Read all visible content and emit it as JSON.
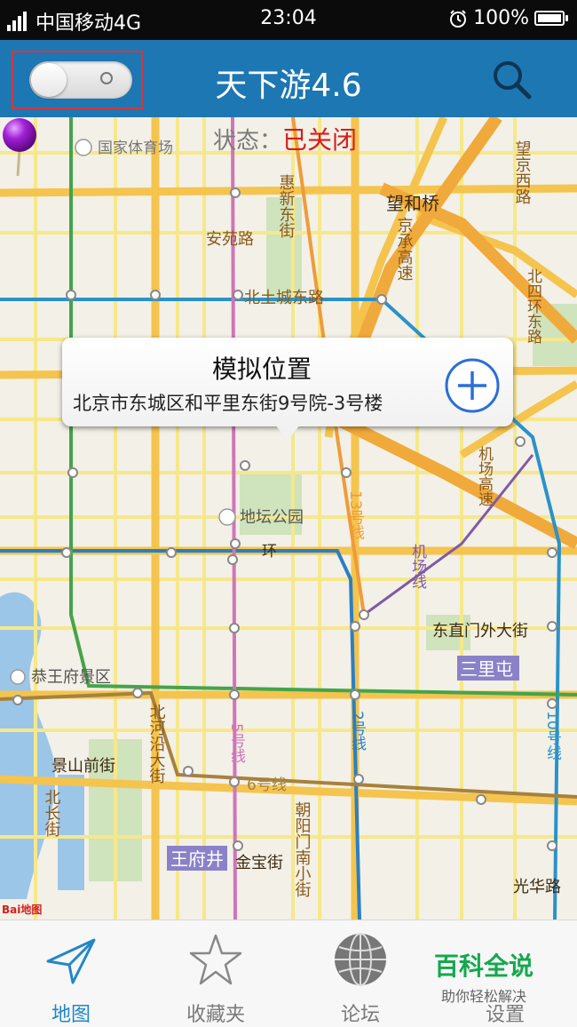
{
  "status_bar": {
    "network_tag": "4G",
    "carrier": "中国移动4G",
    "time": "23:04",
    "battery": "100%",
    "battery_level": 1.0
  },
  "header": {
    "title": "天下游4.6",
    "toggle_on": false
  },
  "map": {
    "status_label": "状态：",
    "status_value": "已关闭",
    "status_color": "#d41e1e",
    "labels": {
      "gymnasium": "国家体育场",
      "anyuan_road": "安苑路",
      "huixin_east": "惠新东街",
      "beituchengdong": "北土城东路",
      "wanghe_bridge": "望和桥",
      "jingcheng_expwy": "京承高速",
      "north_4th_ring": "北四环东路",
      "wangjing_west": "望京西路",
      "ditan_park": "地坛公园",
      "line13": "13号线",
      "airport_line": "机场线",
      "airport_expwy": "机场高速",
      "dongzhimen": "东直门外大街",
      "sanlitun": "三里屯",
      "gongwangfu": "恭王府景区",
      "beiheyan": "北河沿大街",
      "line5": "5号线",
      "line2": "2号线",
      "line6": "6号线",
      "line10": "10号线",
      "jingshan_front": "景山前街",
      "beichang": "北长街",
      "chaoyangmen": "朝阳门南小街",
      "wangfujing": "王府井",
      "jinbao": "金宝街",
      "guanghua": "光华路",
      "ring": "环",
      "baidu": "Bai地图"
    }
  },
  "popup": {
    "title": "模拟位置",
    "address": "北京市东城区和平里东街9号院-3号楼"
  },
  "bottom_nav": {
    "items": [
      {
        "label": "地图",
        "icon": "paper-plane-icon",
        "active": true
      },
      {
        "label": "收藏夹",
        "icon": "star-icon",
        "active": false
      },
      {
        "label": "论坛",
        "icon": "globe-icon",
        "active": false
      },
      {
        "label": "设置",
        "icon": "settings-icon",
        "active": false
      }
    ],
    "watermark_title": "百科全说",
    "watermark_subtitle": "助你轻松解决"
  },
  "colors": {
    "header_bg": "#1d77b2",
    "active_tab": "#2187c8",
    "highlight_frame": "#d9343b"
  }
}
